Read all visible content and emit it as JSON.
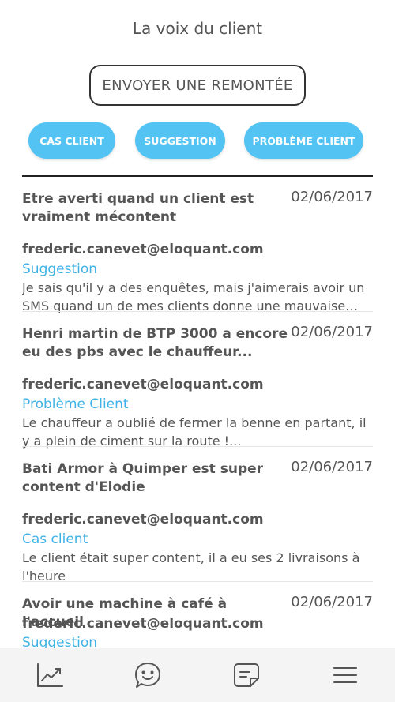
{
  "header": {
    "title": "La voix du client"
  },
  "actions": {
    "submit_label": "ENVOYER UNE REMONTÉE"
  },
  "categories": [
    {
      "label": "CAS CLIENT"
    },
    {
      "label": "SUGGESTION"
    },
    {
      "label": "PROBLÈME CLIENT"
    }
  ],
  "feed": [
    {
      "title": "Etre averti quand un client est vraiment mécontent",
      "date": "02/06/2017",
      "email": "frederic.canevet@eloquant.com",
      "category": "Suggestion",
      "description": "Je sais qu'il y a des enquêtes, mais j'aimerais avoir un SMS quand un de mes clients donne une mauvaise note"
    },
    {
      "title": "Henri martin de BTP 3000 a encore eu des pbs avec le chauffeur...",
      "date": "02/06/2017",
      "email": "frederic.canevet@eloquant.com",
      "category": "Problème Client",
      "description": "Le chauffeur a oublié de fermer la benne en partant, il y a plein de ciment sur la route !..."
    },
    {
      "title": "Bati Armor à Quimper est super content d'Elodie",
      "date": "02/06/2017",
      "email": "frederic.canevet@eloquant.com",
      "category": "Cas client",
      "description": "Le client était super content, il a eu ses 2 livraisons à l'heure"
    },
    {
      "title": "Avoir une machine à café à l'accueil",
      "date": "02/06/2017",
      "email": "frederic.canevet@eloquant.com",
      "category": "Suggestion",
      "description": ""
    }
  ],
  "bottom_nav": [
    {
      "icon": "chart-icon"
    },
    {
      "icon": "chat-smile-icon"
    },
    {
      "icon": "note-icon"
    },
    {
      "icon": "menu-icon"
    }
  ],
  "colors": {
    "accent": "#52c3f2",
    "category_text": "#3fb2e6",
    "text": "#555555"
  }
}
